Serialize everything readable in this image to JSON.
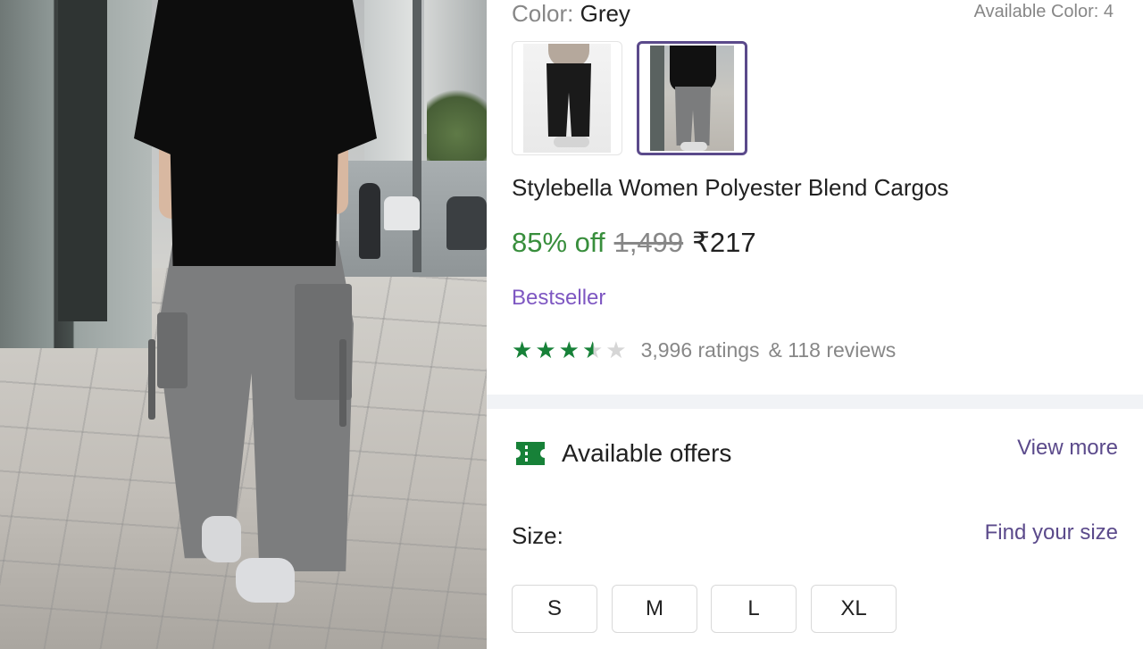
{
  "product": {
    "color_label": "Color:",
    "color_value": "Grey",
    "available_colors": "Available Color: 4",
    "swatches": [
      {
        "name": "black-cargos",
        "selected": false
      },
      {
        "name": "grey-cargos",
        "selected": true
      }
    ],
    "title": "Stylebella Women Polyester Blend Cargos",
    "discount": "85% off",
    "mrp": "1,499",
    "price": "₹217",
    "badge": "Bestseller",
    "rating": 3.5,
    "ratings_count": "3,996 ratings",
    "reviews_count": "& 118 reviews"
  },
  "offers": {
    "icon": "ticket-icon",
    "title": "Available offers",
    "view_more": "View more"
  },
  "size": {
    "label": "Size:",
    "find_size": "Find your size",
    "options": [
      "S",
      "M",
      "L",
      "XL"
    ]
  },
  "colors": {
    "discount_green": "#388e3c",
    "star_green": "#178138",
    "accent_purple": "#5b4a8b",
    "badge_purple": "#7e57c2"
  }
}
